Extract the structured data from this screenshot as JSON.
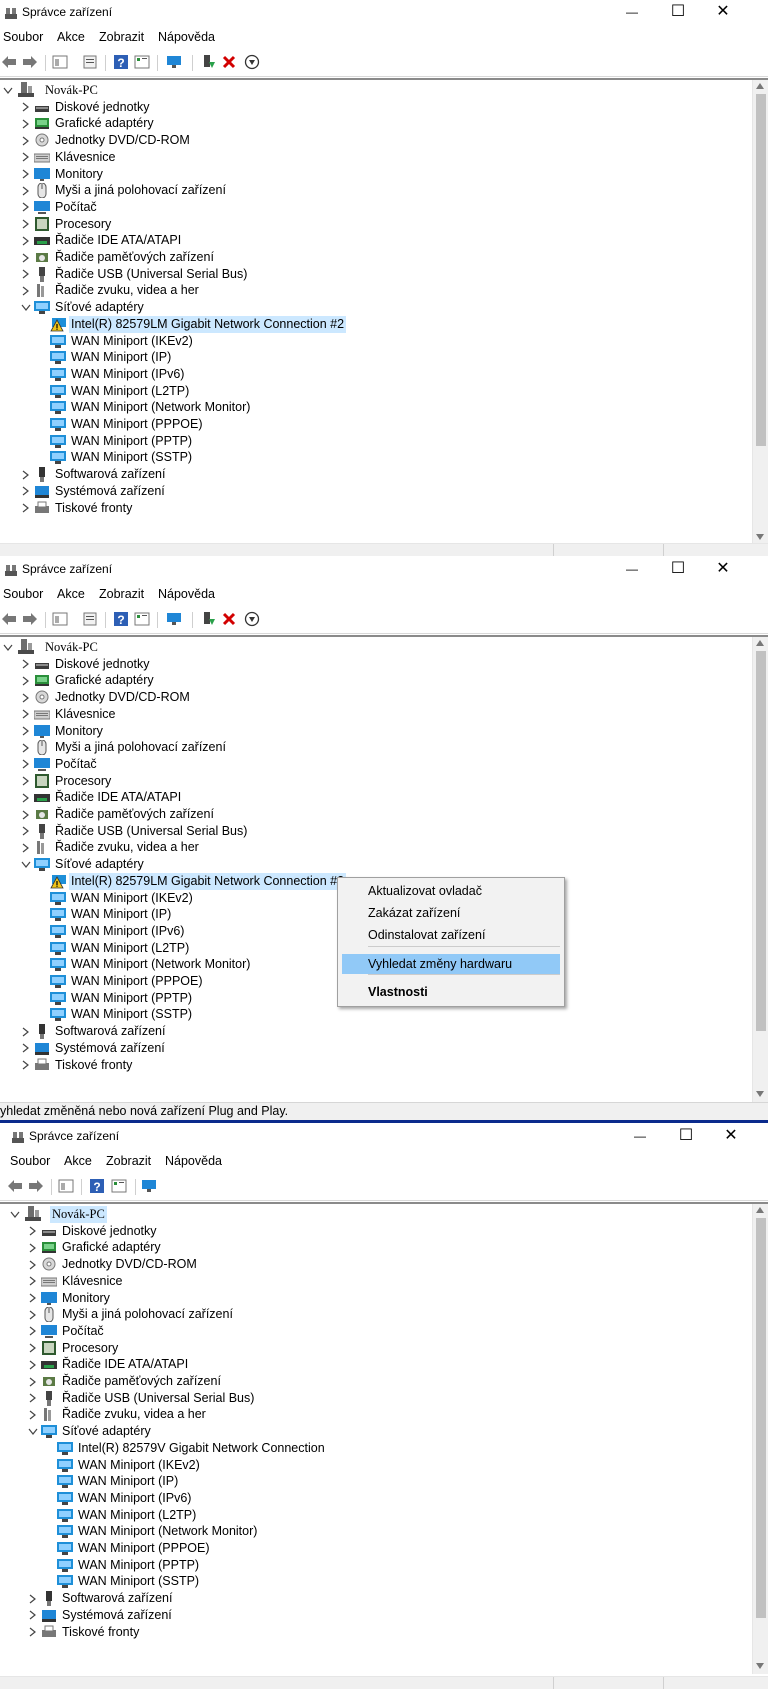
{
  "window": {
    "title": "Správce zařízení",
    "controls": {
      "minimize": "—",
      "maximize": "☐",
      "close": "✕"
    }
  },
  "menu": [
    "Soubor",
    "Akce",
    "Zobrazit",
    "Nápověda"
  ],
  "panels": [
    {
      "root": "Novák-PC",
      "categories": [
        "Diskové jednotky",
        "Grafické adaptéry",
        "Jednotky DVD/CD-ROM",
        "Klávesnice",
        "Monitory",
        "Myši a jiná polohovací zařízení",
        "Počítač",
        "Procesory",
        "Řadiče IDE ATA/ATAPI",
        "Řadiče paměťových zařízení",
        "Řadiče USB (Universal Serial Bus)",
        "Řadiče zvuku, videa a her"
      ],
      "network_category": "Síťové adaptéry",
      "network_items": [
        "Intel(R) 82579LM Gigabit Network Connection #2",
        "WAN Miniport (IKEv2)",
        "WAN Miniport (IP)",
        "WAN Miniport (IPv6)",
        "WAN Miniport (L2TP)",
        "WAN Miniport (Network Monitor)",
        "WAN Miniport (PPPOE)",
        "WAN Miniport (PPTP)",
        "WAN Miniport (SSTP)"
      ],
      "after": [
        "Softwarová zařízení",
        "Systémová zařízení",
        "Tiskové fronty"
      ]
    },
    {
      "root": "Novák-PC",
      "categories": [
        "Diskové jednotky",
        "Grafické adaptéry",
        "Jednotky DVD/CD-ROM",
        "Klávesnice",
        "Monitory",
        "Myši a jiná polohovací zařízení",
        "Počítač",
        "Procesory",
        "Řadiče IDE ATA/ATAPI",
        "Řadiče paměťových zařízení",
        "Řadiče USB (Universal Serial Bus)",
        "Řadiče zvuku, videa a her"
      ],
      "network_category": "Síťové adaptéry",
      "network_items": [
        "Intel(R) 82579LM Gigabit Network Connection #2",
        "WAN Miniport (IKEv2)",
        "WAN Miniport (IP)",
        "WAN Miniport (IPv6)",
        "WAN Miniport (L2TP)",
        "WAN Miniport (Network Monitor)",
        "WAN Miniport (PPPOE)",
        "WAN Miniport (PPTP)",
        "WAN Miniport (SSTP)"
      ],
      "after": [
        "Softwarová zařízení",
        "Systémová zařízení",
        "Tiskové fronty"
      ],
      "context_menu": {
        "items": [
          "Aktualizovat ovladač",
          "Zakázat zařízení",
          "Odinstalovat zařízení",
          "Vyhledat změny hardwaru",
          "Vlastnosti"
        ],
        "highlighted": "Vyhledat změny hardwaru"
      },
      "status": "yhledat změněná nebo nová zařízení Plug and Play."
    },
    {
      "root": "Novák-PC",
      "categories": [
        "Diskové jednotky",
        "Grafické adaptéry",
        "Jednotky DVD/CD-ROM",
        "Klávesnice",
        "Monitory",
        "Myši a jiná polohovací zařízení",
        "Počítač",
        "Procesory",
        "Řadiče IDE ATA/ATAPI",
        "Řadiče paměťových zařízení",
        "Řadiče USB (Universal Serial Bus)",
        "Řadiče zvuku, videa a her"
      ],
      "network_category": "Síťové adaptéry",
      "network_items": [
        "Intel(R) 82579V Gigabit Network Connection",
        "WAN Miniport (IKEv2)",
        "WAN Miniport (IP)",
        "WAN Miniport (IPv6)",
        "WAN Miniport (L2TP)",
        "WAN Miniport (Network Monitor)",
        "WAN Miniport (PPPOE)",
        "WAN Miniport (PPTP)",
        "WAN Miniport (SSTP)"
      ],
      "after": [
        "Softwarová zařízení",
        "Systémová zařízení",
        "Tiskové fronty"
      ]
    }
  ],
  "colors": {
    "selection": "#cce8ff",
    "menu_highlight": "#91c9f7",
    "divider": "#0a2a8c",
    "network_icon": "#1e8fd8",
    "warning": "#f0c419"
  },
  "icons": {
    "category_icons": [
      "disk-drive-icon",
      "display-adapter-icon",
      "dvd-drive-icon",
      "keyboard-icon",
      "monitor-icon",
      "mouse-icon",
      "computer-icon",
      "processor-icon",
      "ide-controller-icon",
      "storage-controller-icon",
      "usb-controller-icon",
      "sound-controller-icon"
    ],
    "after_icons": [
      "software-device-icon",
      "system-device-icon",
      "printer-queue-icon"
    ]
  }
}
